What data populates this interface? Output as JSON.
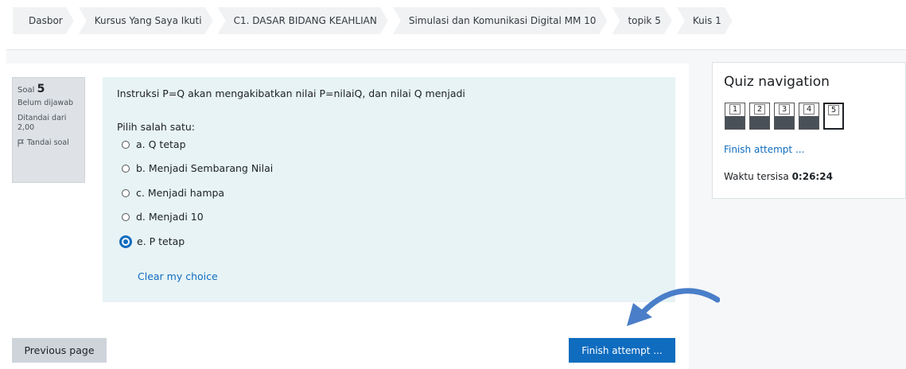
{
  "breadcrumb": [
    "Dasbor",
    "Kursus Yang Saya Ikuti",
    "C1. DASAR BIDANG KEAHLIAN",
    "Simulasi dan Komunikasi Digital MM 10",
    "topik 5",
    "Kuis 1"
  ],
  "question_info": {
    "label": "Soal",
    "number": "5",
    "status": "Belum dijawab",
    "marked": "Ditandai dari 2,00",
    "flag_label": "Tandai soal"
  },
  "question": {
    "text": "Instruksi P=Q akan mengakibatkan nilai P=nilaiQ, dan nilai Q menjadi",
    "prompt": "Pilih salah satu:",
    "options": [
      {
        "label": "a. Q tetap",
        "selected": false
      },
      {
        "label": "b. Menjadi Sembarang Nilai",
        "selected": false
      },
      {
        "label": "c. Menjadi hampa",
        "selected": false
      },
      {
        "label": "d. Menjadi 10",
        "selected": false
      },
      {
        "label": "e. P tetap",
        "selected": true
      }
    ],
    "clear_label": "Clear my choice"
  },
  "buttons": {
    "previous": "Previous page",
    "finish": "Finish attempt ..."
  },
  "quiz_nav": {
    "title": "Quiz navigation",
    "questions": [
      "1",
      "2",
      "3",
      "4",
      "5"
    ],
    "current": "5",
    "finish_link": "Finish attempt ...",
    "time_label": "Waktu tersisa",
    "time_value": "0:26:24"
  },
  "colors": {
    "accent": "#0f6cbf",
    "question_bg": "#e7f3f5",
    "arrow": "#4a7ec9"
  }
}
